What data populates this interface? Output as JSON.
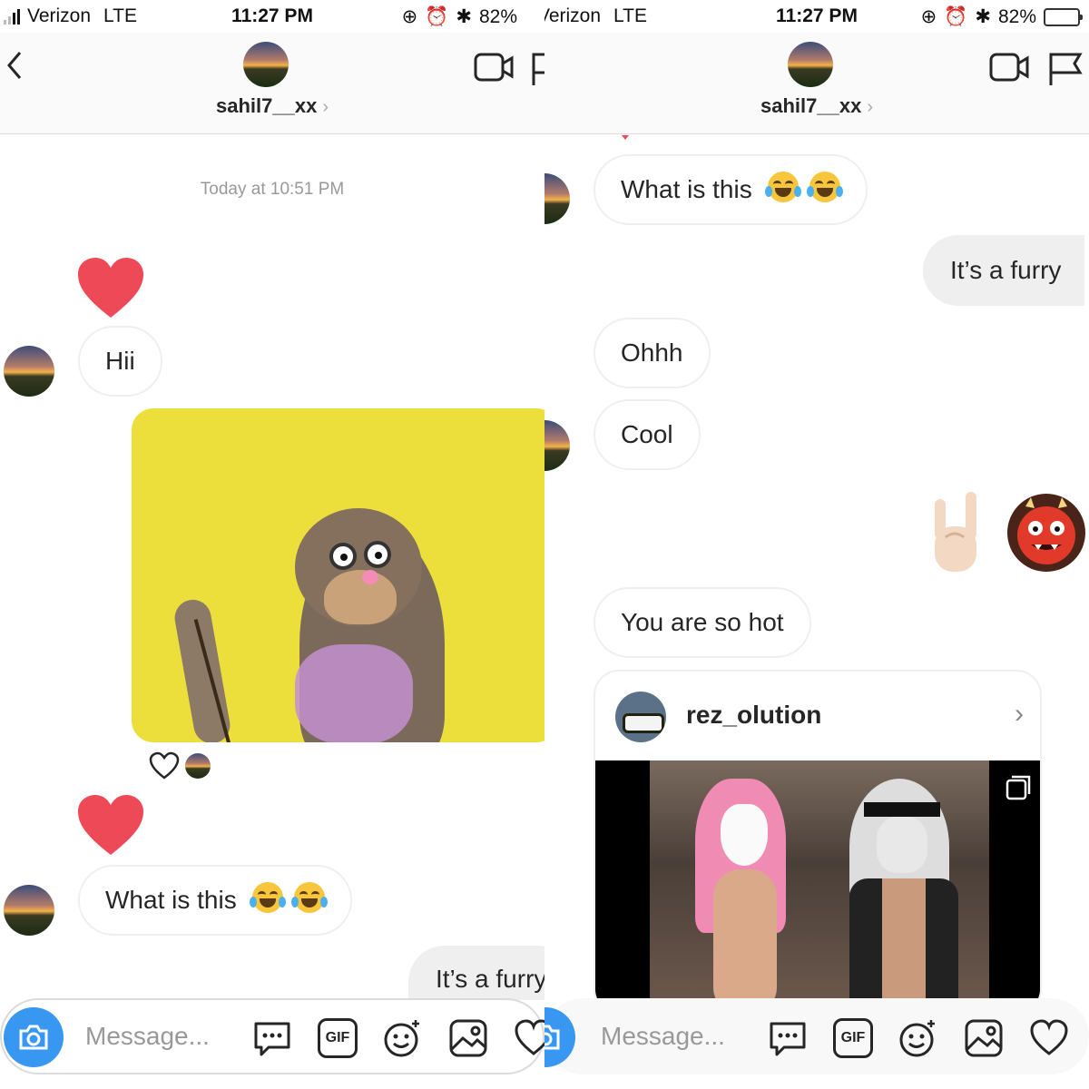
{
  "status": {
    "carrier": "Verizon",
    "network": "LTE",
    "time": "11:27 PM",
    "battery_pct": "82%",
    "battery_level": 0.82,
    "colors": {
      "battery": "#4cd964"
    }
  },
  "nav": {
    "username": "sahil7__xx",
    "chevron": "›"
  },
  "left": {
    "timestamp": "Today at 10:51 PM",
    "messages": {
      "hii": "Hii",
      "what_is_this": "What is this",
      "partial_out": "It’s a furry"
    }
  },
  "right": {
    "messages": {
      "what_is_this": "What is this",
      "its_a_furry": "It’s a furry",
      "ohhh": "Ohhh",
      "cool": "Cool",
      "you_are_so_hot": "You are so hot"
    },
    "shared_post": {
      "username": "rez_olution",
      "chevron": "›"
    }
  },
  "composer": {
    "placeholder": "Message...",
    "gif_label": "GIF"
  },
  "icons": {
    "back": "back-chevron-icon",
    "video": "video-call-icon",
    "flag": "flag-icon",
    "camera": "camera-icon",
    "chat": "chat-bubble-icon",
    "sticker": "sticker-icon",
    "gallery": "gallery-icon",
    "like": "heart-icon"
  },
  "colors": {
    "accent": "#3897f0",
    "heart": "#ed4956",
    "bubble_border": "#efefef",
    "bubble_out": "#efefef"
  }
}
